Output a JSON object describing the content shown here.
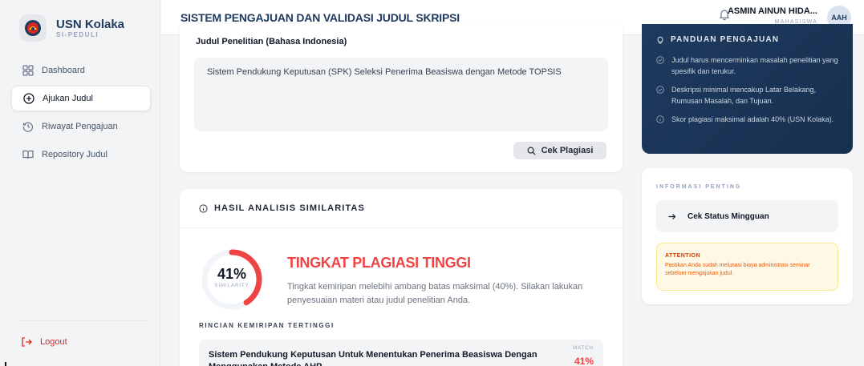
{
  "brand": {
    "name": "USN Kolaka",
    "sub": "SI-PEDULI"
  },
  "sidebar": {
    "items": [
      {
        "label": "Dashboard",
        "icon": "grid-icon",
        "active": false
      },
      {
        "label": "Ajukan Judul",
        "icon": "plus-circle-icon",
        "active": true
      },
      {
        "label": "Riwayat Pengajuan",
        "icon": "history-icon",
        "active": false
      },
      {
        "label": "Repository Judul",
        "icon": "book-open-icon",
        "active": false
      }
    ],
    "logout": "Logout"
  },
  "topbar": {
    "title": "SISTEM PENGAJUAN DAN VALIDASI JUDUL SKRIPSI",
    "user_name": "ASMIN AINUN HIDA...",
    "user_role": "MAHASISWA",
    "avatar_initials": "AAH"
  },
  "form": {
    "label": "Judul Penelitian (Bahasa Indonesia)",
    "value": "Sistem Pendukung Keputusan (SPK) Seleksi Penerima Beasiswa dengan Metode TOPSIS",
    "check_button": "Cek Plagiasi"
  },
  "result": {
    "heading": "HASIL ANALISIS SIMILARITAS",
    "percent": 41,
    "percent_text": "41%",
    "percent_label": "SIMILARITY",
    "risk_title": "TINGKAT PLAGIASI TINGGI",
    "risk_desc": "Tingkat kemiripan melebihi ambang batas maksimal (40%). Silakan lakukan penyesuaian materi atau judul penelitian Anda.",
    "details_heading": "RINCIAN KEMIRIPAN TERTINGGI",
    "matches": [
      {
        "title": "Sistem Pendukung Keputusan Untuk Menentukan Penerima Beasiswa Dengan Menggunakan Metode AHP",
        "match_label": "MATCH",
        "match_value": "41%"
      }
    ]
  },
  "guide": {
    "title": "PANDUAN PENGAJUAN",
    "items": [
      "Judul harus mencerminkan masalah penelitian yang spesifik dan terukur.",
      "Deskripsi minimal mencakup Latar Belakang, Rumusan Masalah, dan Tujuan.",
      "Skor plagiasi maksimal adalah 40% (USN Kolaka)."
    ]
  },
  "info": {
    "title": "INFORMASI PENTING",
    "button": "Cek Status Mingguan",
    "attention_heading": "ATTENTION",
    "attention_text": "Pastikan Anda sudah melunasi biaya administrasi seminar sebelum mengajukan judul."
  },
  "colors": {
    "brand_navy": "#1e3a5f",
    "danger": "#ef4444",
    "warning": "#ea580c"
  }
}
